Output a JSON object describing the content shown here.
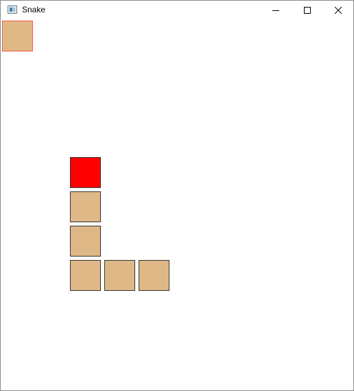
{
  "window": {
    "title": "Snake",
    "icon": "app-window-icon",
    "controls": {
      "minimize": "minimize-icon",
      "maximize": "maximize-icon",
      "close": "close-icon"
    }
  },
  "game": {
    "colors": {
      "head": "#ff0000",
      "body": "#deb887",
      "outline": "#333333",
      "food": "#deb887",
      "food_outline": "#ff5a4a",
      "background": "#ffffff"
    }
  }
}
